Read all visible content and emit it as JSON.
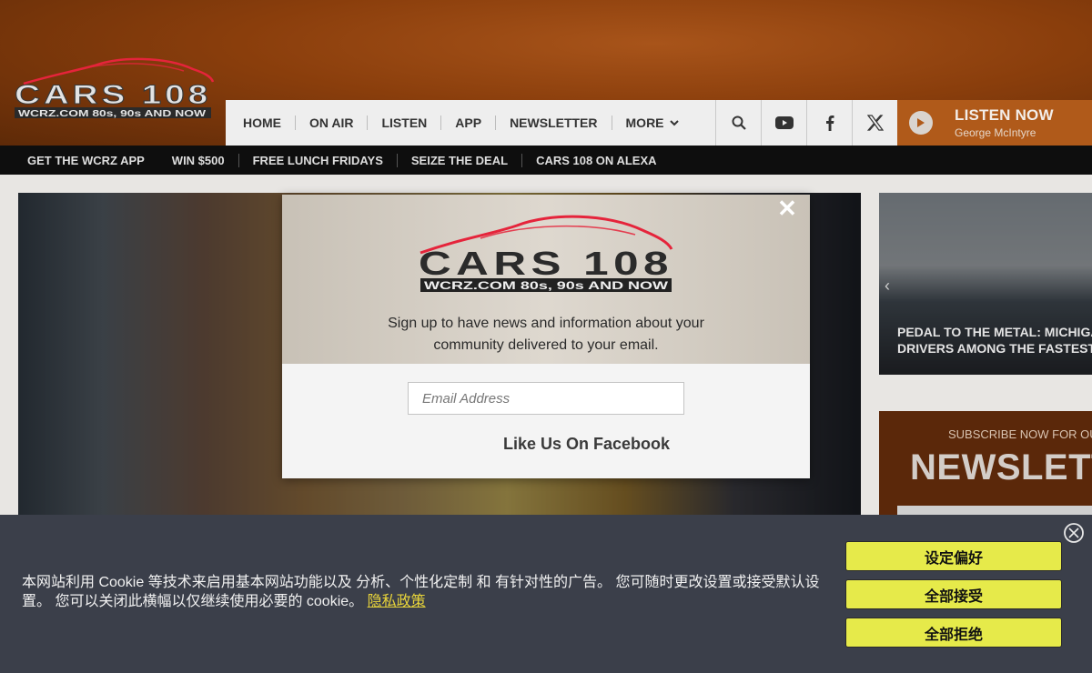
{
  "brand": {
    "logo_text": "CARS 108",
    "logo_tagline": "WCRZ.COM 80s, 90s AND NOW",
    "accent_color": "#e5243b"
  },
  "nav": {
    "items": [
      "HOME",
      "ON AIR",
      "LISTEN",
      "APP",
      "NEWSLETTER",
      "MORE"
    ],
    "icons": [
      "search-icon",
      "youtube-icon",
      "facebook-icon",
      "x-icon"
    ]
  },
  "listen": {
    "title": "LISTEN NOW",
    "subtitle": "George McIntyre"
  },
  "subnav": {
    "items": [
      "GET THE WCRZ APP",
      "WIN $500",
      "FREE LUNCH FRIDAYS",
      "SEIZE THE DEAL",
      "CARS 108 ON ALEXA"
    ]
  },
  "side_card": {
    "caption_line1": "PEDAL TO THE METAL: MICHIGAN",
    "caption_line2": "DRIVERS AMONG THE FASTEST IN T"
  },
  "newsletter_box": {
    "subtitle": "SUBSCRIBE NOW FOR OUR",
    "title": "NEWSLETTE"
  },
  "modal": {
    "line1": "Sign up to have news and information about your",
    "line2": "community delivered to your email.",
    "email_placeholder": "Email Address",
    "facebook_label": "Like Us On Facebook",
    "close_symbol": "✕"
  },
  "cookie": {
    "text": "本网站利用 Cookie 等技术来启用基本网站功能以及 分析、个性化定制 和 有针对性的广告。 您可随时更改设置或接受默认设置。 您可以关闭此横幅以仅继续使用必要的 cookie。",
    "privacy_link": "隐私政策",
    "buttons": [
      "设定偏好",
      "全部接受",
      "全部拒绝"
    ]
  }
}
